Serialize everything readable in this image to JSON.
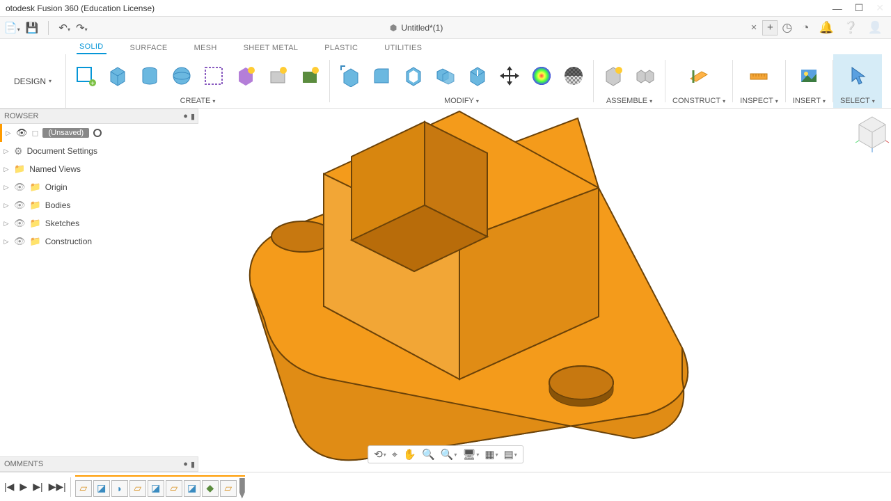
{
  "window": {
    "title": "otodesk Fusion 360 (Education License)"
  },
  "tab": {
    "name": "Untitled*(1)"
  },
  "workspace": "DESIGN",
  "ribbon_tabs": [
    "SOLID",
    "SURFACE",
    "MESH",
    "SHEET METAL",
    "PLASTIC",
    "UTILITIES"
  ],
  "ribbon_active_tab": "SOLID",
  "ribbon_panels": {
    "create": "CREATE",
    "modify": "MODIFY",
    "assemble": "ASSEMBLE",
    "construct": "CONSTRUCT",
    "inspect": "INSPECT",
    "insert": "INSERT",
    "select": "SELECT"
  },
  "browser": {
    "title": "ROWSER",
    "root": "(Unsaved)",
    "items": [
      {
        "label": "Document Settings",
        "icon": "gear",
        "visible": true
      },
      {
        "label": "Named Views",
        "icon": "folder",
        "visible": true
      },
      {
        "label": "Origin",
        "icon": "folder",
        "visible": false
      },
      {
        "label": "Bodies",
        "icon": "folder",
        "visible": false
      },
      {
        "label": "Sketches",
        "icon": "folder",
        "visible": false
      },
      {
        "label": "Construction",
        "icon": "folder",
        "visible": false
      }
    ]
  },
  "comments": {
    "title": "OMMENTS"
  },
  "timeline": {
    "items": [
      "sketch",
      "extrude",
      "fillet",
      "sketch",
      "extrude",
      "sketch",
      "extrude",
      "construct",
      "sketch"
    ]
  },
  "colors": {
    "accent": "#0696d7",
    "model": "#f49b1b",
    "model_dark": "#d17e0a",
    "highlight": "#ff9b00"
  }
}
